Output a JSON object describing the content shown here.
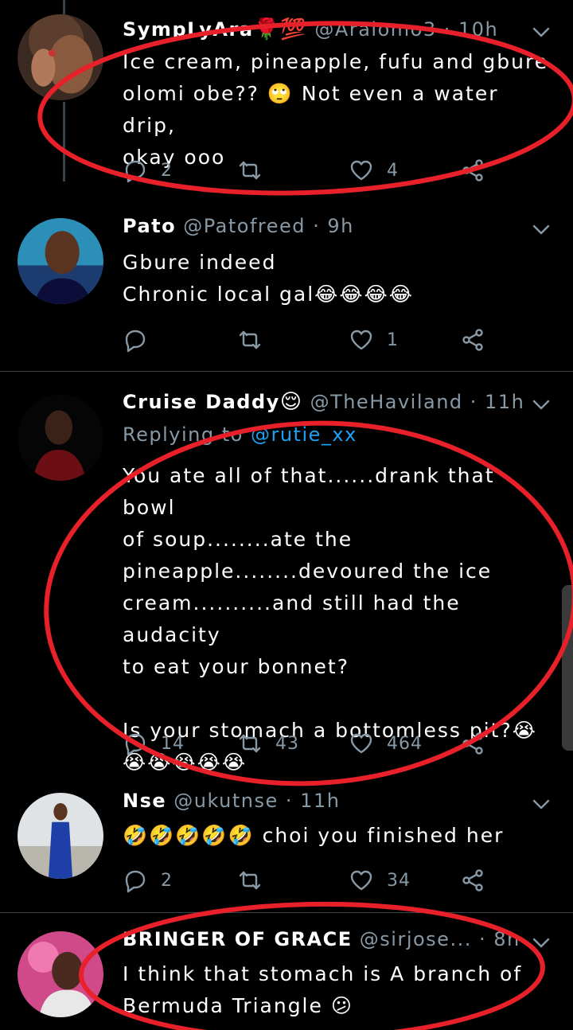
{
  "tweets": [
    {
      "name": "SympLyAra",
      "name_emoji": "🌹💯",
      "handle": "@Aralomo3",
      "time": "· 10h",
      "body": "Ice cream, pineapple, fufu and gbure\nolomi obe?? 🙄 Not even a water drip,\nokay ooo",
      "replies": "2",
      "retweets": "",
      "likes": "4"
    },
    {
      "name": "Pato",
      "name_emoji": "",
      "handle": "@Patofreed",
      "time": "· 9h",
      "body": "Gbure indeed\nChronic local gal😂😂😂😂",
      "replies": "",
      "retweets": "",
      "likes": "1"
    },
    {
      "name": "Cruise Daddy",
      "name_emoji": "😌",
      "handle": "@TheHaviland",
      "time": "· 11h",
      "replying_prefix": "Replying to",
      "replying_to": "@rutie_xx",
      "body": "You ate all of that......drank that bowl\nof soup........ate the\npineapple........devoured the ice\ncream..........and still had the audacity\nto eat your bonnet?\n\nIs your stomach a bottomless pit?😭\n😭😭😭😭😭",
      "replies": "14",
      "retweets": "43",
      "likes": "464"
    },
    {
      "name": "Nse",
      "name_emoji": "",
      "handle": "@ukutnse",
      "time": "· 11h",
      "body": "🤣🤣🤣🤣🤣 choi you finished her",
      "replies": "2",
      "retweets": "",
      "likes": "34"
    },
    {
      "name": "BRINGER OF GRACE",
      "name_emoji": "",
      "handle": "@sirjose...",
      "time": "· 8h",
      "body": "I think that stomach is A branch of\nBermuda Triangle 😕",
      "replies": "",
      "retweets": "",
      "likes": ""
    }
  ],
  "colors": {
    "background": "#000000",
    "secondary_text": "#8899a6",
    "mention": "#1da1f2",
    "annotation_ring": "#e8202a",
    "divider": "#38444d"
  },
  "icons": [
    "chevron-down-icon",
    "reply-icon",
    "retweet-icon",
    "like-icon",
    "share-icon"
  ]
}
